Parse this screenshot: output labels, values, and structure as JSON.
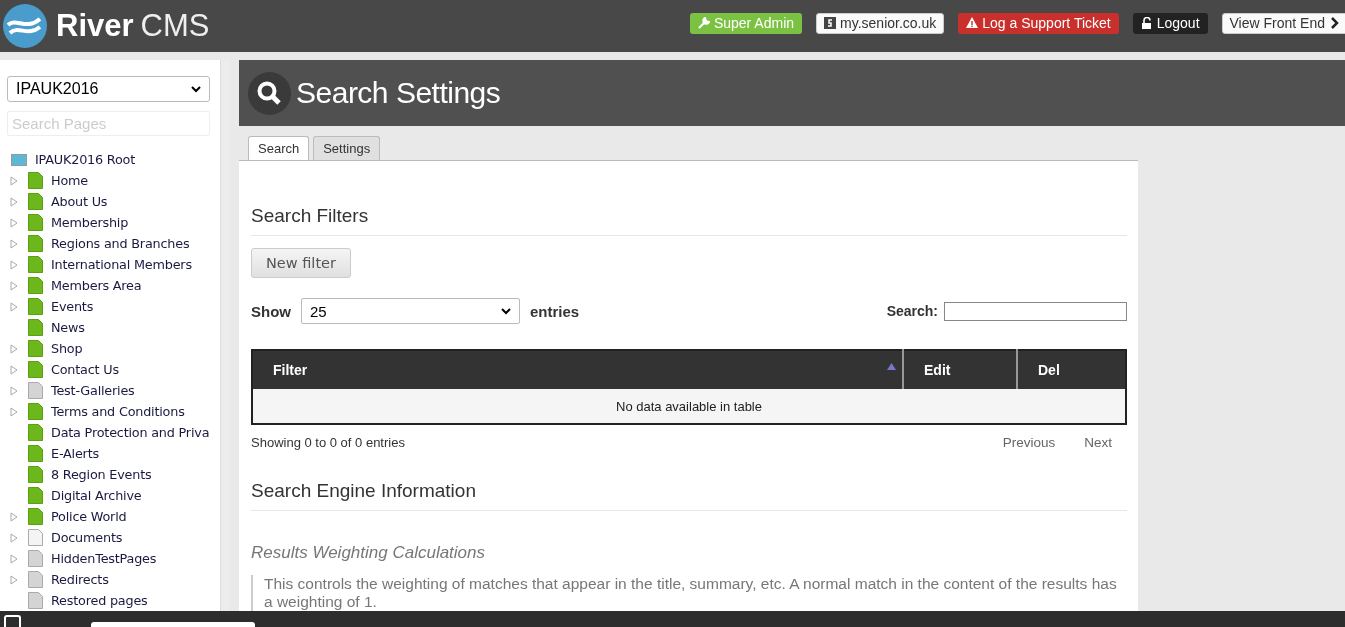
{
  "header": {
    "logo": {
      "word1": "River",
      "word2": "CMS"
    },
    "buttons": [
      {
        "label": "Super Admin",
        "kind": "admin"
      },
      {
        "label": "my.senior.co.uk",
        "kind": "site"
      },
      {
        "label": "Log a Support Ticket",
        "kind": "ticket"
      },
      {
        "label": "Logout",
        "kind": "logout"
      },
      {
        "label": "View Front End",
        "kind": "front"
      }
    ]
  },
  "sidebar": {
    "site_select": "IPAUK2016",
    "search": {
      "placeholder": "Search Pages"
    },
    "tree": {
      "label": "IPAUK2016 Root",
      "children": [
        {
          "label": "Home",
          "kind": "green",
          "expandable": true
        },
        {
          "label": "About Us",
          "kind": "green",
          "expandable": true
        },
        {
          "label": "Membership",
          "kind": "green",
          "expandable": true
        },
        {
          "label": "Regions and Branches",
          "kind": "green",
          "expandable": true
        },
        {
          "label": "International Members",
          "kind": "green",
          "expandable": true
        },
        {
          "label": "Members Area",
          "kind": "green",
          "expandable": true
        },
        {
          "label": "Events",
          "kind": "green",
          "expandable": true
        },
        {
          "label": "News",
          "kind": "green",
          "expandable": false
        },
        {
          "label": "Shop",
          "kind": "green",
          "expandable": true
        },
        {
          "label": "Contact Us",
          "kind": "green",
          "expandable": true
        },
        {
          "label": "Test-Galleries",
          "kind": "grey",
          "expandable": true
        },
        {
          "label": "Terms and Conditions",
          "kind": "green",
          "expandable": true
        },
        {
          "label": "Data Protection and Priva",
          "kind": "green",
          "expandable": false
        },
        {
          "label": "E-Alerts",
          "kind": "green",
          "expandable": false
        },
        {
          "label": "8 Region Events",
          "kind": "green",
          "expandable": false
        },
        {
          "label": "Digital Archive",
          "kind": "green",
          "expandable": false
        },
        {
          "label": "Police World",
          "kind": "green",
          "expandable": true
        },
        {
          "label": "Documents",
          "kind": "white",
          "expandable": true
        },
        {
          "label": "HiddenTestPages",
          "kind": "grey",
          "expandable": true
        },
        {
          "label": "Redirects",
          "kind": "grey",
          "expandable": true
        },
        {
          "label": "Restored pages",
          "kind": "grey",
          "expandable": false
        }
      ]
    }
  },
  "page": {
    "title": "Search Settings",
    "tabs": [
      {
        "label": "Search",
        "selected": true
      },
      {
        "label": "Settings",
        "selected": false
      }
    ],
    "filters": {
      "heading": "Search Filters",
      "new_button": "New filter",
      "show_label": "Show",
      "page_size": "25",
      "entries_label": "entries",
      "search_label": "Search:",
      "table": {
        "columns": [
          {
            "label": "Filter",
            "sorted": true
          },
          {
            "label": "Edit",
            "sorted": false
          },
          {
            "label": "Del",
            "sorted": false
          }
        ],
        "empty": "No data available in table"
      },
      "info": "Showing 0 to 0 of 0 entries",
      "previous": "Previous",
      "next": "Next"
    },
    "engine": {
      "heading": "Search Engine Information",
      "subheading": "Results Weighting Calculations",
      "note": "This controls the weighting of matches that appear in the title, summary, etc. A normal match in the content of the results has a weighting of 1."
    }
  }
}
